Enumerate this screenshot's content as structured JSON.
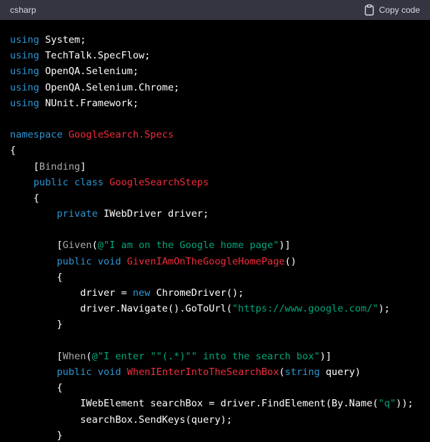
{
  "header": {
    "language": "csharp",
    "copy_label": "Copy code"
  },
  "colors": {
    "keyword": "#2e95d3",
    "class_name": "#f22c3d",
    "string": "#00a67d",
    "attribute": "#a9aaab",
    "text": "#ffffff",
    "header_bg": "#343541",
    "code_bg": "#000000"
  },
  "code_lines": [
    [
      {
        "t": "kw",
        "v": "using"
      },
      {
        "t": "p",
        "v": " System;"
      }
    ],
    [
      {
        "t": "kw",
        "v": "using"
      },
      {
        "t": "p",
        "v": " TechTalk.SpecFlow;"
      }
    ],
    [
      {
        "t": "kw",
        "v": "using"
      },
      {
        "t": "p",
        "v": " OpenQA.Selenium;"
      }
    ],
    [
      {
        "t": "kw",
        "v": "using"
      },
      {
        "t": "p",
        "v": " OpenQA.Selenium.Chrome;"
      }
    ],
    [
      {
        "t": "kw",
        "v": "using"
      },
      {
        "t": "p",
        "v": " NUnit.Framework;"
      }
    ],
    [],
    [
      {
        "t": "kw",
        "v": "namespace"
      },
      {
        "t": "p",
        "v": " "
      },
      {
        "t": "cls",
        "v": "GoogleSearch.Specs"
      }
    ],
    [
      {
        "t": "p",
        "v": "{"
      }
    ],
    [
      {
        "t": "p",
        "v": "    ["
      },
      {
        "t": "attr",
        "v": "Binding"
      },
      {
        "t": "p",
        "v": "]"
      }
    ],
    [
      {
        "t": "p",
        "v": "    "
      },
      {
        "t": "kw",
        "v": "public"
      },
      {
        "t": "p",
        "v": " "
      },
      {
        "t": "kw",
        "v": "class"
      },
      {
        "t": "p",
        "v": " "
      },
      {
        "t": "cls",
        "v": "GoogleSearchSteps"
      }
    ],
    [
      {
        "t": "p",
        "v": "    {"
      }
    ],
    [
      {
        "t": "p",
        "v": "        "
      },
      {
        "t": "kw",
        "v": "private"
      },
      {
        "t": "p",
        "v": " IWebDriver driver;"
      }
    ],
    [],
    [
      {
        "t": "p",
        "v": "        ["
      },
      {
        "t": "attr",
        "v": "Given"
      },
      {
        "t": "p",
        "v": "("
      },
      {
        "t": "str",
        "v": "@\"I am on the Google home page\""
      },
      {
        "t": "p",
        "v": ")]"
      }
    ],
    [
      {
        "t": "p",
        "v": "        "
      },
      {
        "t": "kw",
        "v": "public"
      },
      {
        "t": "p",
        "v": " "
      },
      {
        "t": "kw",
        "v": "void"
      },
      {
        "t": "p",
        "v": " "
      },
      {
        "t": "cls",
        "v": "GivenIAmOnTheGoogleHomePage"
      },
      {
        "t": "p",
        "v": "()"
      }
    ],
    [
      {
        "t": "p",
        "v": "        {"
      }
    ],
    [
      {
        "t": "p",
        "v": "            driver = "
      },
      {
        "t": "kw",
        "v": "new"
      },
      {
        "t": "p",
        "v": " ChromeDriver();"
      }
    ],
    [
      {
        "t": "p",
        "v": "            driver.Navigate().GoToUrl("
      },
      {
        "t": "str",
        "v": "\"https://www.google.com/\""
      },
      {
        "t": "p",
        "v": ");"
      }
    ],
    [
      {
        "t": "p",
        "v": "        }"
      }
    ],
    [],
    [
      {
        "t": "p",
        "v": "        ["
      },
      {
        "t": "attr",
        "v": "When"
      },
      {
        "t": "p",
        "v": "("
      },
      {
        "t": "str",
        "v": "@\"I enter \"\"(.*)\"\" into the search box\""
      },
      {
        "t": "p",
        "v": ")]"
      }
    ],
    [
      {
        "t": "p",
        "v": "        "
      },
      {
        "t": "kw",
        "v": "public"
      },
      {
        "t": "p",
        "v": " "
      },
      {
        "t": "kw",
        "v": "void"
      },
      {
        "t": "p",
        "v": " "
      },
      {
        "t": "cls",
        "v": "WhenIEnterIntoTheSearchBox"
      },
      {
        "t": "p",
        "v": "("
      },
      {
        "t": "kw",
        "v": "string"
      },
      {
        "t": "p",
        "v": " query)"
      }
    ],
    [
      {
        "t": "p",
        "v": "        {"
      }
    ],
    [
      {
        "t": "p",
        "v": "            IWebElement searchBox = driver.FindElement(By.Name("
      },
      {
        "t": "str",
        "v": "\"q\""
      },
      {
        "t": "p",
        "v": "));"
      }
    ],
    [
      {
        "t": "p",
        "v": "            searchBox.SendKeys(query);"
      }
    ],
    [
      {
        "t": "p",
        "v": "        }"
      }
    ]
  ]
}
